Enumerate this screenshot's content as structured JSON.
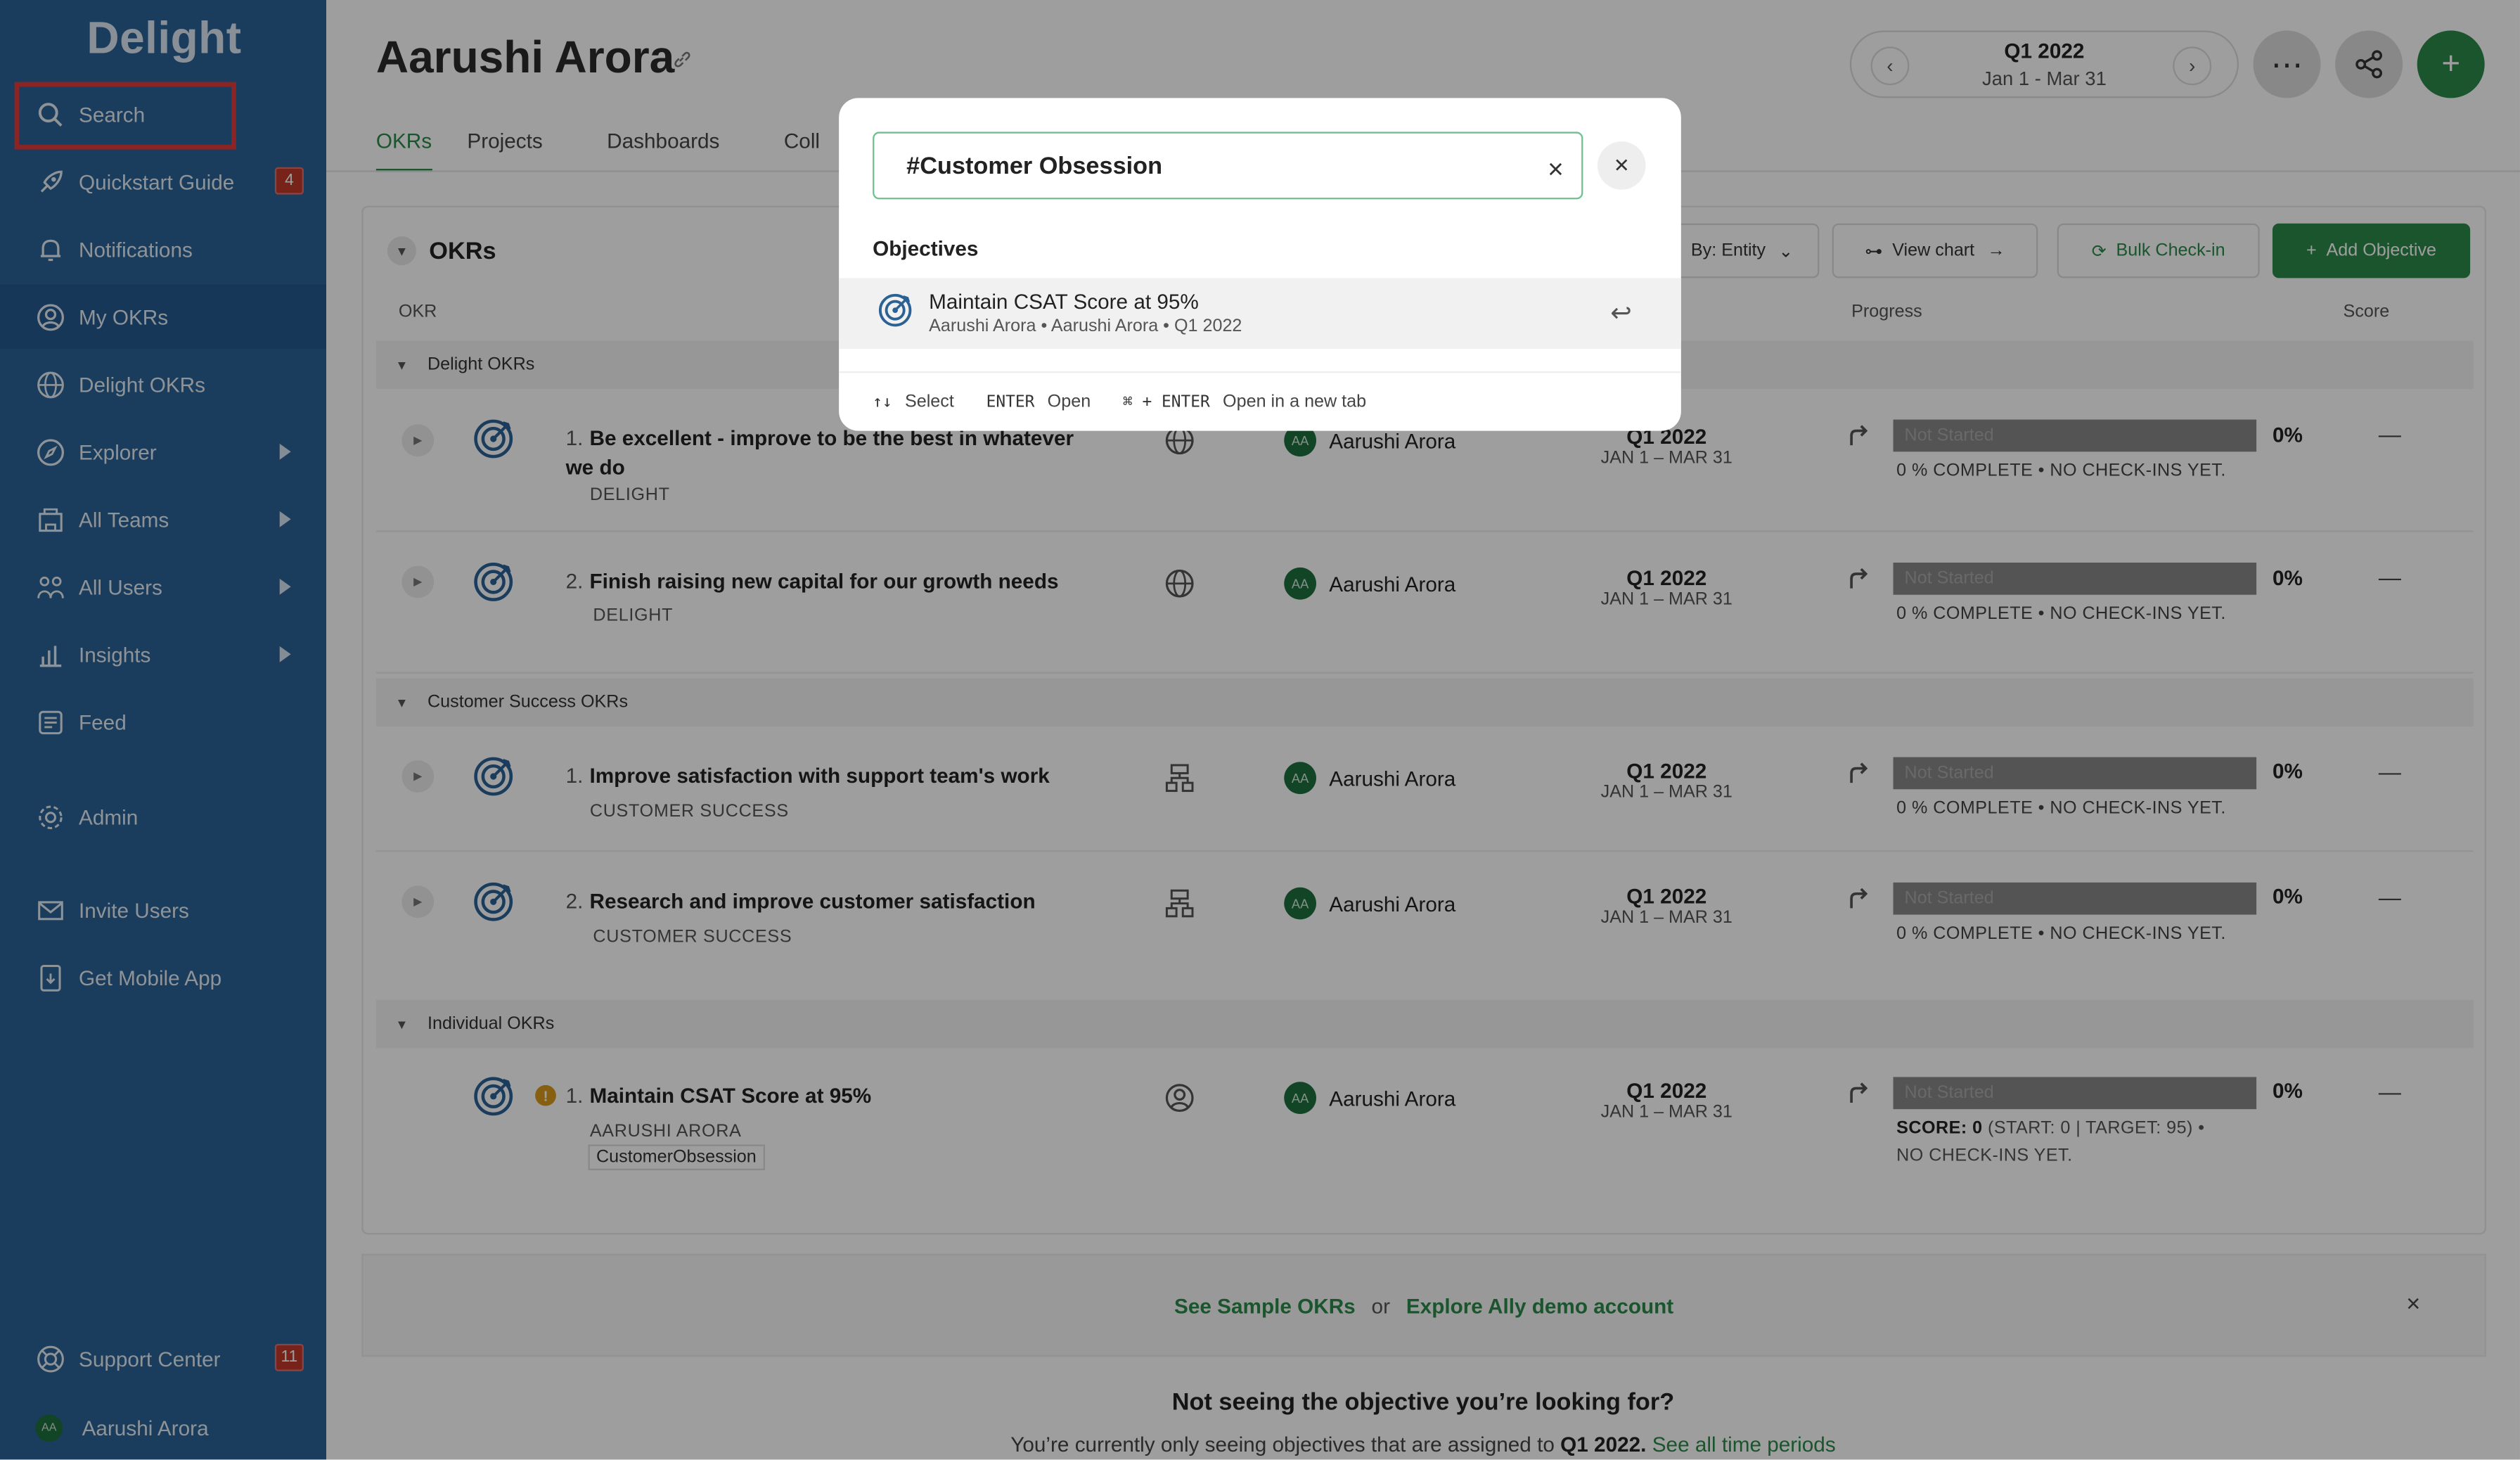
{
  "app": {
    "logo": "Delight"
  },
  "sidebar": {
    "items": [
      {
        "label": "Search",
        "icon": "search-icon"
      },
      {
        "label": "Quickstart Guide",
        "icon": "rocket-icon",
        "badge": "4"
      },
      {
        "label": "Notifications",
        "icon": "bell-icon"
      },
      {
        "label": "My OKRs",
        "icon": "user-circle-icon"
      },
      {
        "label": "Delight OKRs",
        "icon": "globe-icon"
      },
      {
        "label": "Explorer",
        "icon": "compass-icon"
      },
      {
        "label": "All Teams",
        "icon": "teams-icon"
      },
      {
        "label": "All Users",
        "icon": "users-icon"
      },
      {
        "label": "Insights",
        "icon": "chart-icon"
      },
      {
        "label": "Feed",
        "icon": "feed-icon"
      },
      {
        "label": "Admin",
        "icon": "gear-icon"
      },
      {
        "label": "Invite Users",
        "icon": "mail-icon"
      },
      {
        "label": "Get Mobile App",
        "icon": "mobile-icon"
      },
      {
        "label": "Support Center",
        "icon": "lifebuoy-icon",
        "badge": "11"
      }
    ],
    "user": {
      "name": "Aarushi Arora",
      "initials": "AA"
    }
  },
  "header": {
    "title": "Aarushi Arora",
    "period": {
      "quarter": "Q1 2022",
      "range": "Jan 1 - Mar 31"
    },
    "tabs": [
      "OKRs",
      "Projects",
      "Dashboards",
      "Coll"
    ]
  },
  "okrs": {
    "heading": "OKRs",
    "toolbar": {
      "group_by": "By: Entity",
      "view_chart": "View chart",
      "bulk_checkin": "Bulk Check-in",
      "add_objective": "Add Objective"
    },
    "columns": {
      "okr": "OKR",
      "progress": "Progress",
      "score": "Score"
    },
    "groups": [
      {
        "name": "Delight OKRs"
      },
      {
        "name": "Customer Success OKRs"
      },
      {
        "name": "Individual OKRs"
      }
    ],
    "rows": [
      {
        "num": "1.",
        "title": "Be excellent - improve to be the best in whatever we do",
        "sub": "DELIGHT",
        "owner": "Aarushi Arora",
        "period": "Q1 2022",
        "range": "JAN 1 – MAR 31",
        "status": "Not Started",
        "pct": "0%",
        "note": "0 % COMPLETE • NO CHECK-INS YET.",
        "score": "—"
      },
      {
        "num": "2.",
        "title": "Finish raising new capital for our growth needs",
        "sub": "DELIGHT",
        "owner": "Aarushi Arora",
        "period": "Q1 2022",
        "range": "JAN 1 – MAR 31",
        "status": "Not Started",
        "pct": "0%",
        "note": "0 % COMPLETE • NO CHECK-INS YET.",
        "score": "—"
      },
      {
        "num": "1.",
        "title": "Improve satisfaction with support team's work",
        "sub": "CUSTOMER SUCCESS",
        "owner": "Aarushi Arora",
        "period": "Q1 2022",
        "range": "JAN 1 – MAR 31",
        "status": "Not Started",
        "pct": "0%",
        "note": "0 % COMPLETE • NO CHECK-INS YET.",
        "score": "—"
      },
      {
        "num": "2.",
        "title": "Research and improve customer satisfaction",
        "sub": "CUSTOMER SUCCESS",
        "owner": "Aarushi Arora",
        "period": "Q1 2022",
        "range": "JAN 1 – MAR 31",
        "status": "Not Started",
        "pct": "0%",
        "note": "0 % COMPLETE • NO CHECK-INS YET.",
        "score": "—"
      },
      {
        "num": "1.",
        "title": "Maintain CSAT Score at 95%",
        "sub": "AARUSHI ARORA",
        "tag": "CustomerObsession",
        "owner": "Aarushi Arora",
        "period": "Q1 2022",
        "range": "JAN 1 – MAR 31",
        "status": "Not Started",
        "pct": "0%",
        "note_bold": "SCORE: 0",
        "note": "(START: 0 | TARGET: 95) • NO CHECK-INS YET.",
        "score": "—"
      }
    ]
  },
  "banner": {
    "link1": "See Sample OKRs",
    "or": "or",
    "link2": "Explore Ally demo account",
    "close": "×"
  },
  "footer": {
    "heading": "Not seeing the objective you’re looking for?",
    "text": "You’re currently only seeing objectives that are assigned to",
    "period": "Q1 2022.",
    "link": "See all time periods"
  },
  "search": {
    "query": "#Customer Obsession",
    "section": "Objectives",
    "result": {
      "title": "Maintain CSAT Score at 95%",
      "meta": "Aarushi Arora • Aarushi Arora • Q1 2022"
    },
    "hints": [
      {
        "key": "↑↓",
        "label": "Select"
      },
      {
        "key": "ENTER",
        "label": "Open"
      },
      {
        "key": "⌘ + ENTER",
        "label": "Open in a new tab"
      }
    ]
  },
  "colors": {
    "sidebar": "#2b6296",
    "accent": "#2b8a4b",
    "highlight": "#e03a3a"
  }
}
